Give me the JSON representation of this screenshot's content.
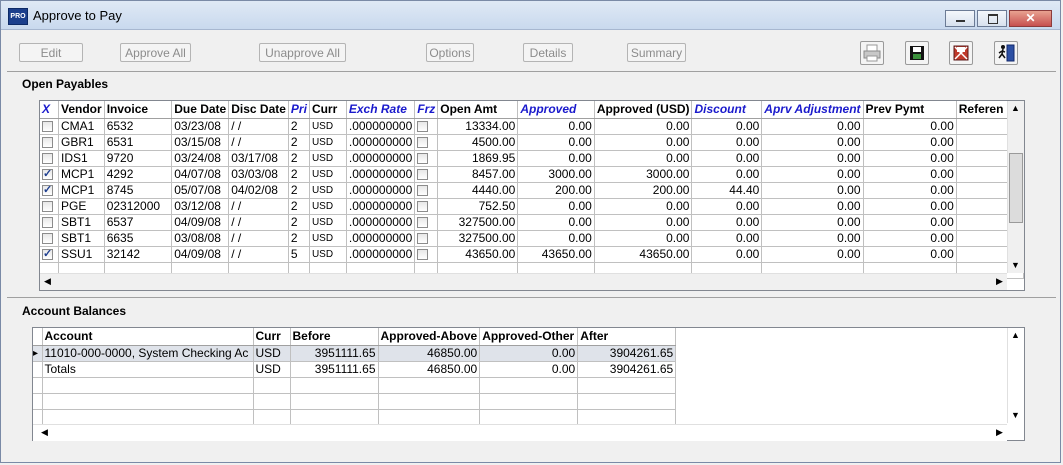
{
  "window": {
    "title": "Approve to Pay",
    "logo_text": "PRO",
    "controls": [
      "minimize-icon",
      "maximize-icon",
      "close-icon"
    ]
  },
  "toolbar": {
    "buttons": [
      {
        "label": "Edit",
        "mnemonic": "E"
      },
      {
        "label": "Approve All",
        "mnemonic": "A"
      },
      {
        "label": "Unapprove All",
        "mnemonic": "U"
      },
      {
        "label": "Options",
        "mnemonic": "O"
      },
      {
        "label": "Details",
        "mnemonic": "D"
      },
      {
        "label": "Summary",
        "mnemonic": "m"
      }
    ],
    "icons": [
      "printer-icon",
      "save-icon",
      "delete-icon",
      "exit-icon"
    ]
  },
  "open_payables": {
    "title": "Open Payables",
    "columns": [
      "X",
      "Vendor",
      "Invoice",
      "Due Date",
      "Disc Date",
      "Pri",
      "Curr",
      "Exch Rate",
      "Frz",
      "Open Amt",
      "Approved",
      "Approved (USD)",
      "Discount",
      "Aprv Adjustment",
      "Prev Pymt",
      "Referen"
    ],
    "rows": [
      {
        "x": false,
        "vendor": "CMA1",
        "invoice": "6532",
        "due": "03/23/08",
        "disc": "/ /",
        "pri": "2",
        "curr": "USD",
        "exch": ".000000000",
        "open": "13334.00",
        "approved": "0.00",
        "approved_usd": "0.00",
        "discount": "0.00",
        "adj": "0.00",
        "prev": "0.00"
      },
      {
        "x": false,
        "vendor": "GBR1",
        "invoice": "6531",
        "due": "03/15/08",
        "disc": "/ /",
        "pri": "2",
        "curr": "USD",
        "exch": ".000000000",
        "open": "4500.00",
        "approved": "0.00",
        "approved_usd": "0.00",
        "discount": "0.00",
        "adj": "0.00",
        "prev": "0.00"
      },
      {
        "x": false,
        "vendor": "IDS1",
        "invoice": "9720",
        "due": "03/24/08",
        "disc": "03/17/08",
        "pri": "2",
        "curr": "USD",
        "exch": ".000000000",
        "open": "1869.95",
        "approved": "0.00",
        "approved_usd": "0.00",
        "discount": "0.00",
        "adj": "0.00",
        "prev": "0.00"
      },
      {
        "x": true,
        "vendor": "MCP1",
        "invoice": "4292",
        "due": "04/07/08",
        "disc": "03/03/08",
        "pri": "2",
        "curr": "USD",
        "exch": ".000000000",
        "open": "8457.00",
        "approved": "3000.00",
        "approved_usd": "3000.00",
        "discount": "0.00",
        "adj": "0.00",
        "prev": "0.00"
      },
      {
        "x": true,
        "vendor": "MCP1",
        "invoice": "8745",
        "due": "05/07/08",
        "disc": "04/02/08",
        "pri": "2",
        "curr": "USD",
        "exch": ".000000000",
        "open": "4440.00",
        "approved": "200.00",
        "approved_usd": "200.00",
        "discount": "44.40",
        "adj": "0.00",
        "prev": "0.00"
      },
      {
        "x": false,
        "vendor": "PGE",
        "invoice": "02312000",
        "due": "03/12/08",
        "disc": "/ /",
        "pri": "2",
        "curr": "USD",
        "exch": ".000000000",
        "open": "752.50",
        "approved": "0.00",
        "approved_usd": "0.00",
        "discount": "0.00",
        "adj": "0.00",
        "prev": "0.00"
      },
      {
        "x": false,
        "vendor": "SBT1",
        "invoice": "6537",
        "due": "04/09/08",
        "disc": "/ /",
        "pri": "2",
        "curr": "USD",
        "exch": ".000000000",
        "open": "327500.00",
        "approved": "0.00",
        "approved_usd": "0.00",
        "discount": "0.00",
        "adj": "0.00",
        "prev": "0.00"
      },
      {
        "x": false,
        "vendor": "SBT1",
        "invoice": "6635",
        "due": "03/08/08",
        "disc": "/ /",
        "pri": "2",
        "curr": "USD",
        "exch": ".000000000",
        "open": "327500.00",
        "approved": "0.00",
        "approved_usd": "0.00",
        "discount": "0.00",
        "adj": "0.00",
        "prev": "0.00"
      },
      {
        "x": true,
        "vendor": "SSU1",
        "invoice": "32142",
        "due": "04/09/08",
        "disc": "/ /",
        "pri": "5",
        "curr": "USD",
        "exch": ".000000000",
        "open": "43650.00",
        "approved": "43650.00",
        "approved_usd": "43650.00",
        "discount": "0.00",
        "adj": "0.00",
        "prev": "0.00"
      }
    ]
  },
  "account_balances": {
    "title": "Account Balances",
    "columns": [
      "Account",
      "Curr",
      "Before",
      "Approved-Above",
      "Approved-Other",
      "After"
    ],
    "rows": [
      {
        "account": "11010-000-0000, System Checking Ac",
        "curr": "USD",
        "before": "3951111.65",
        "above": "46850.00",
        "other": "0.00",
        "after": "3904261.65",
        "selected": true
      },
      {
        "account": "Totals",
        "curr": "USD",
        "before": "3951111.65",
        "above": "46850.00",
        "other": "0.00",
        "after": "3904261.65",
        "selected": false
      }
    ]
  },
  "colors": {
    "title_bar": "#c9d9ee",
    "header_blue": "#1a1acc",
    "selected_row": "#dfe3ea"
  }
}
